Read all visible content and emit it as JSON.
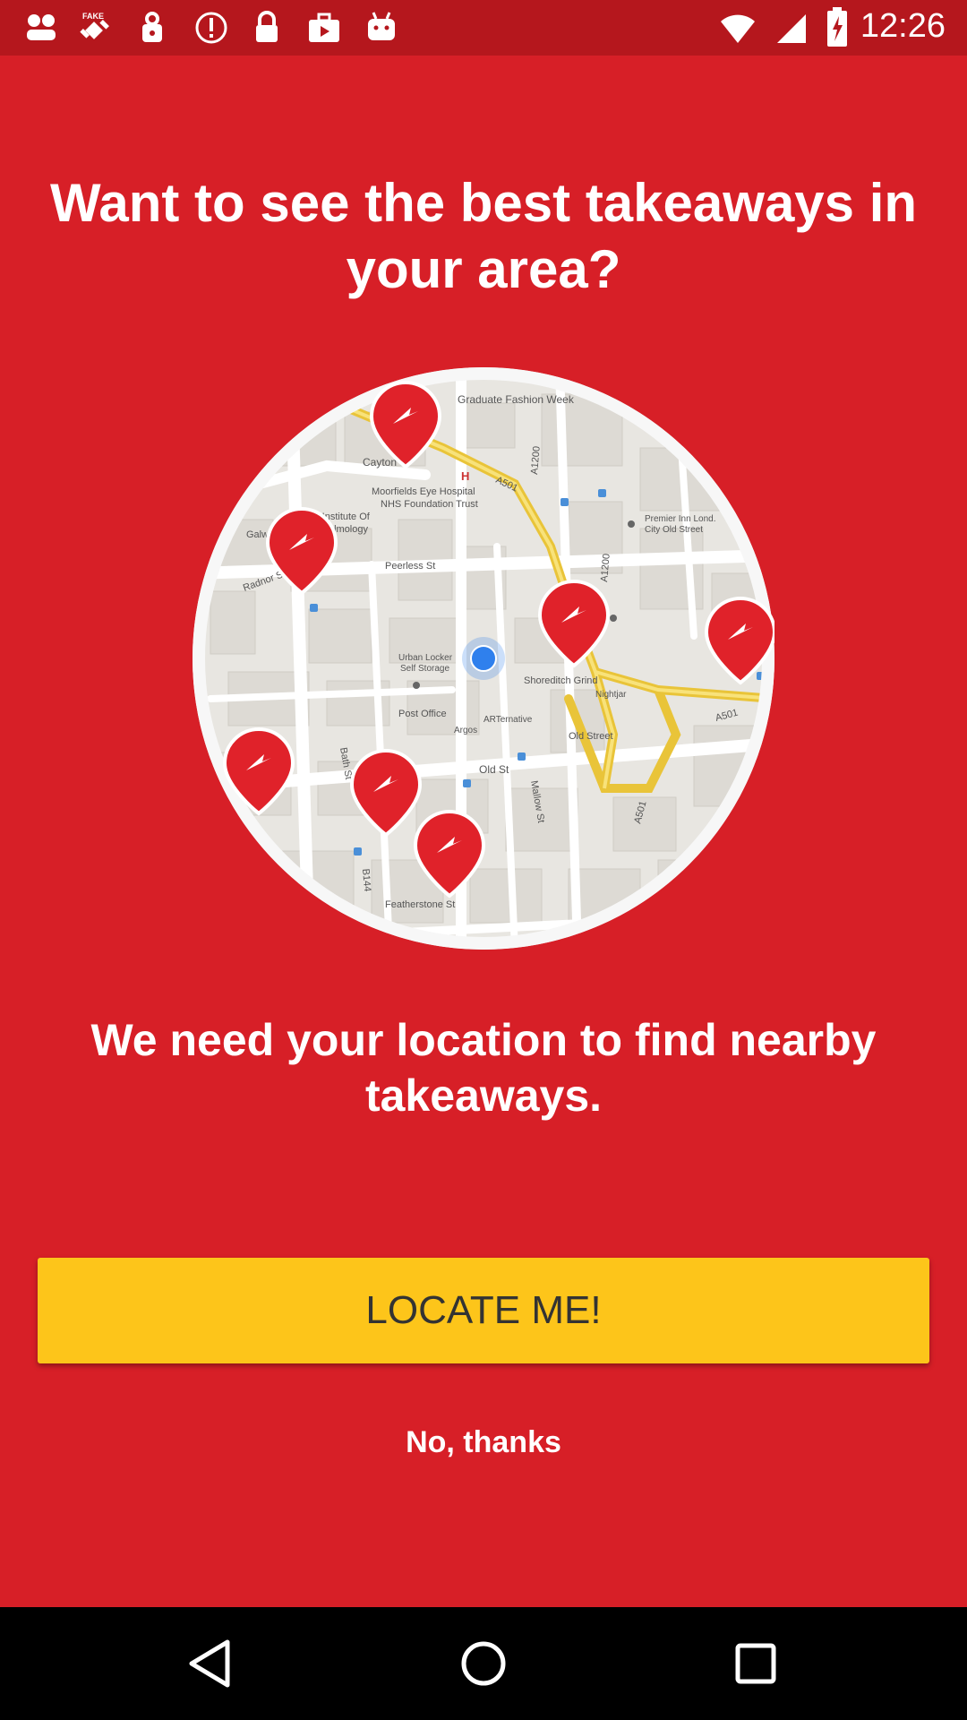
{
  "status_bar": {
    "time": "12:26",
    "icons": [
      "notification-icon",
      "fake-gps-icon",
      "lock-icon",
      "alert-icon",
      "lock-icon",
      "briefcase-icon",
      "android-icon",
      "wifi-icon",
      "signal-icon",
      "battery-icon"
    ]
  },
  "headline": "Want to see the best takeaways in your area?",
  "map": {
    "labels": {
      "graduate": "Graduate Fashion Week",
      "cayton": "Cayton St",
      "moorfields_1": "Moorfields Eye Hospital",
      "moorfields_2": "NHS Foundation Trust",
      "ucl_1": "UCL Institute Of",
      "ucl_2": "Ophthalmology",
      "galway": "Galway",
      "radnor": "Radnor St",
      "peerless": "Peerless St",
      "premier_1": "Premier Inn Lond.",
      "premier_2": "City Old Street",
      "urban_1": "Urban Locker",
      "urban_2": "Self Storage",
      "shoreditch": "Shoreditch Grind",
      "nightjar": "Nightjar",
      "post_office": "Post Office",
      "arternative": "ARTernative",
      "old_street_station": "Old Street",
      "old_st": "Old St",
      "bath": "Bath St",
      "mallow": "Mallow St",
      "argos": "Argos",
      "b144": "B144",
      "featherstone": "Featherstone St",
      "a501_top": "A501",
      "a501_right": "A501",
      "a501_bottom": "A501",
      "a1200_top": "A1200",
      "a1200_mid": "A1200",
      "h": "H"
    }
  },
  "subtext": "We need your location to find nearby takeaways.",
  "buttons": {
    "locate": "LOCATE ME!",
    "no_thanks": "No, thanks"
  },
  "colors": {
    "background": "#d71f27",
    "status_bar": "#b5171d",
    "button": "#fdc51a",
    "pin": "#e0222a",
    "location_dot": "#2f80ed"
  }
}
